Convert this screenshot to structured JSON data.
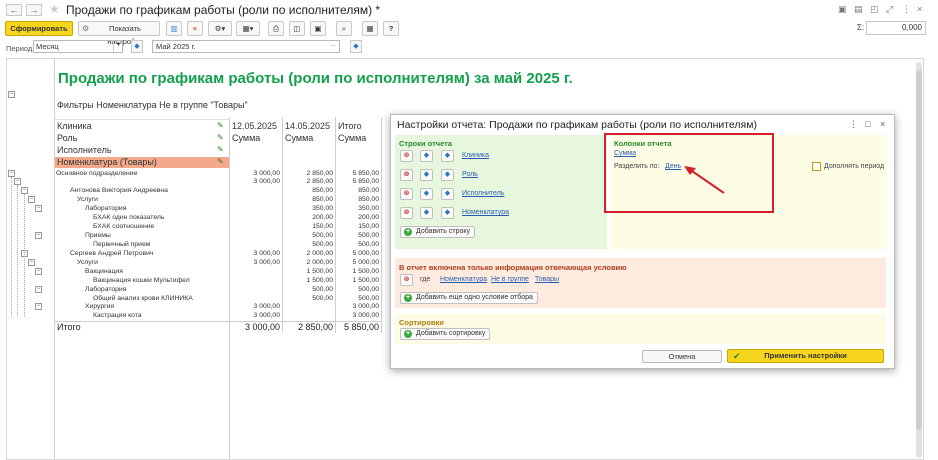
{
  "window": {
    "title": "Продажи по графикам работы (роли по исполнителям) *",
    "nav_back": "←",
    "nav_forward": "→",
    "star": "★"
  },
  "toolbar": {
    "form_label": "Сформировать",
    "settings_label": "Показать настройки",
    "sum_label": "Σ:",
    "sum_value": "0,000"
  },
  "period": {
    "label": "Период:",
    "type": "Месяц",
    "value": "Май 2025 г."
  },
  "report": {
    "title": "Продажи по графикам работы (роли по исполнителям) за май 2025 г.",
    "filter": "Фильтры Номенклатура Не в группе \"Товары\"",
    "groupings": [
      "Клиника",
      "Роль",
      "Исполнитель",
      "Номенклатура (Товары)"
    ],
    "columns": [
      {
        "date": "12.05.2025",
        "sub": "Сумма"
      },
      {
        "date": "14.05.2025",
        "sub": "Сумма"
      },
      {
        "date": "Итого",
        "sub": "Сумма"
      }
    ],
    "rows": [
      {
        "label": "Основное подразделение",
        "c1": "3 000,00",
        "c2": "2 850,00",
        "c3": "5 850,00"
      },
      {
        "label": "",
        "c1": "3 000,00",
        "c2": "2 850,00",
        "c3": "5 850,00"
      },
      {
        "label": "Антонова Виктория Андреевна",
        "c1": "",
        "c2": "850,00",
        "c3": "850,00"
      },
      {
        "label": "Услуги",
        "c1": "",
        "c2": "850,00",
        "c3": "850,00"
      },
      {
        "label": "Лаборатория",
        "c1": "",
        "c2": "350,00",
        "c3": "350,00"
      },
      {
        "label": "БХАК один показатель",
        "c1": "",
        "c2": "200,00",
        "c3": "200,00"
      },
      {
        "label": "БХАК соотношение",
        "c1": "",
        "c2": "150,00",
        "c3": "150,00"
      },
      {
        "label": "Приемы",
        "c1": "",
        "c2": "500,00",
        "c3": "500,00"
      },
      {
        "label": "Первичный прием",
        "c1": "",
        "c2": "500,00",
        "c3": "500,00"
      },
      {
        "label": "Сергеев Андрей Петрович",
        "c1": "3 000,00",
        "c2": "2 000,00",
        "c3": "5 000,00"
      },
      {
        "label": "Услуги",
        "c1": "3 000,00",
        "c2": "2 000,00",
        "c3": "5 000,00"
      },
      {
        "label": "Вакцинация",
        "c1": "",
        "c2": "1 500,00",
        "c3": "1 500,00"
      },
      {
        "label": "Вакцинация кошки Мультифел",
        "c1": "",
        "c2": "1 500,00",
        "c3": "1 500,00"
      },
      {
        "label": "Лаборатория",
        "c1": "",
        "c2": "500,00",
        "c3": "500,00"
      },
      {
        "label": "Общий анализ крови КЛИНИКА",
        "c1": "",
        "c2": "500,00",
        "c3": "500,00"
      },
      {
        "label": "Хирургия",
        "c1": "3 000,00",
        "c2": "",
        "c3": "3 000,00"
      },
      {
        "label": "Кастрация кота",
        "c1": "3 000,00",
        "c2": "",
        "c3": "3 000,00"
      }
    ],
    "total": {
      "label": "Итого",
      "c1": "3 000,00",
      "c2": "2 850,00",
      "c3": "5 850,00"
    }
  },
  "dialog": {
    "title": "Настройки отчета: Продажи по графикам работы (роли по исполнителям)",
    "rows_title": "Строки отчета",
    "rows": [
      "Клиника",
      "Роль",
      "Исполнитель",
      "Номенклатура"
    ],
    "add_row": "Добавить строку",
    "cols_title": "Колонки отчета",
    "cols_value": "Сумма",
    "split_label": "Разделить по:",
    "split_value": "День",
    "extend_period": "Дополнять период",
    "filter_title": "В отчет включена только информация отвечающая условию",
    "filter_where": "где",
    "filter_field": "Номенклатура",
    "filter_cond": "Не в группе",
    "filter_value": "Товары",
    "add_filter": "Добавить еще одно условие отбора",
    "sort_title": "Сортировки",
    "add_sort": "Добавить сортировку",
    "cancel": "Отмена",
    "apply": "Применить настройки"
  },
  "colors": {
    "accent_yellow": "#f7d41e",
    "title_green": "#12a14b",
    "highlight_red": "#d8202a",
    "grouping_highlight": "#f3a98a"
  }
}
